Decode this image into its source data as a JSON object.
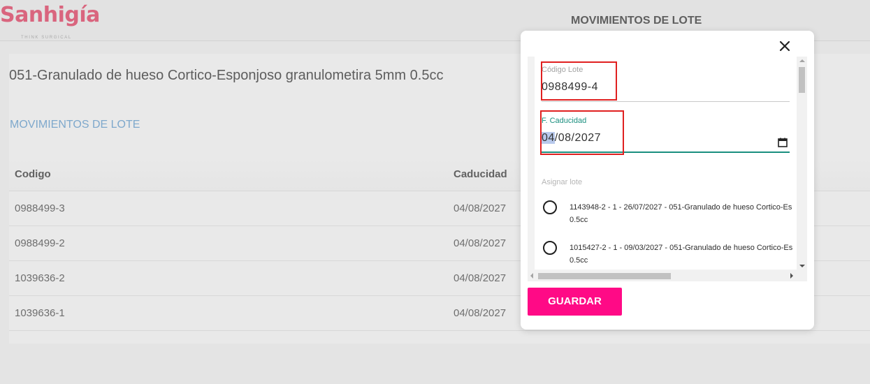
{
  "header": {
    "logo_text": "Sanhigía",
    "logo_tagline": "THINK SURGICAL",
    "title": "MOVIMIENTOS DE LOTE"
  },
  "main": {
    "product_title": "051-Granulado de hueso Cortico-Esponjoso granulometira 5mm 0.5cc",
    "section_title": "MOVIMIENTOS DE LOTE",
    "table": {
      "columns": [
        "Codigo",
        "Caducidad"
      ],
      "rows": [
        {
          "codigo": "0988499-3",
          "caducidad": "04/08/2027"
        },
        {
          "codigo": "0988499-2",
          "caducidad": "04/08/2027"
        },
        {
          "codigo": "1039636-2",
          "caducidad": "04/08/2027"
        },
        {
          "codigo": "1039636-1",
          "caducidad": "04/08/2027"
        }
      ]
    }
  },
  "modal": {
    "close_icon": "close-icon",
    "codigo_lote": {
      "label": "Código Lote",
      "value": "0988499-4"
    },
    "fecha_caducidad": {
      "label": "F. Caducidad",
      "day": "04",
      "rest": "/08/2027",
      "icon": "calendar-icon"
    },
    "assign_label": "Asignar lote",
    "options": [
      {
        "line1": "1143948-2 - 1 - 26/07/2027 - 051-Granulado de hueso Cortico-Es",
        "line2": "0.5cc"
      },
      {
        "line1": "1015427-2 - 1 - 09/03/2027 - 051-Granulado de hueso Cortico-Es",
        "line2": "0.5cc"
      }
    ],
    "save_label": "GUARDAR"
  },
  "colors": {
    "brand": "#d9657e",
    "accent_button": "#ff0a86",
    "section_title": "#7ea8cc",
    "focus_underline": "#1a8f7f",
    "highlight_box": "#e02020"
  }
}
